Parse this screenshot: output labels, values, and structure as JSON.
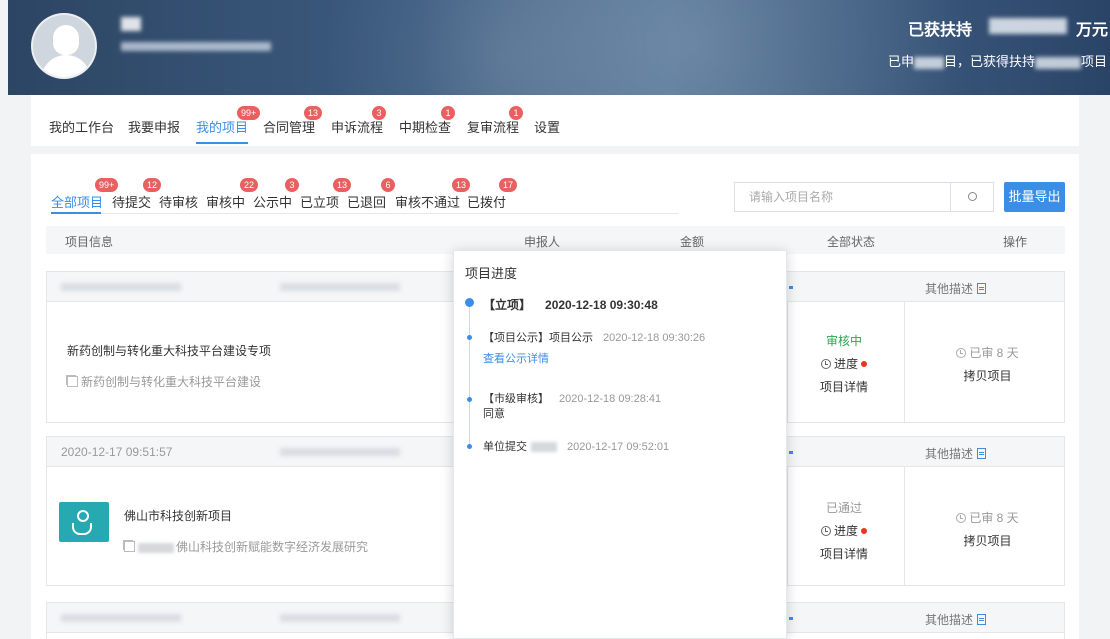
{
  "header": {
    "support_title": "已获扶持",
    "support_unit": "万元",
    "support_sub_a": "已申",
    "support_sub_b": "目，已获得扶持",
    "support_sub_c": "项目"
  },
  "nav": {
    "items": [
      {
        "label": "我的工作台"
      },
      {
        "label": "我要申报"
      },
      {
        "label": "我的项目",
        "badge": "99+"
      },
      {
        "label": "合同管理",
        "badge": "13"
      },
      {
        "label": "申诉流程",
        "badge": "3"
      },
      {
        "label": "中期检查",
        "badge": "1"
      },
      {
        "label": "复审流程",
        "badge": "1"
      },
      {
        "label": "设置"
      }
    ]
  },
  "filters": [
    {
      "label": "全部项目",
      "badge": "99+"
    },
    {
      "label": "待提交",
      "badge": "12"
    },
    {
      "label": "待审核"
    },
    {
      "label": "审核中",
      "badge": "22"
    },
    {
      "label": "公示中",
      "badge": "3"
    },
    {
      "label": "已立项",
      "badge": "13"
    },
    {
      "label": "已退回",
      "badge": "6"
    },
    {
      "label": "审核不通过",
      "badge": "13"
    },
    {
      "label": "已拨付",
      "badge": "17"
    }
  ],
  "search": {
    "placeholder": "请输入项目名称"
  },
  "export_label": "批量导出",
  "table": {
    "headers": [
      "项目信息",
      "申报人",
      "金额",
      "全部状态",
      "操作"
    ]
  },
  "rows": [
    {
      "time": "",
      "name": "新药创制与转化重大科技平台建设专项",
      "sub": "新药创制与转化重大科技平台建设",
      "status": "审核中",
      "progress": "进度",
      "detail": "项目详情",
      "days": "已审 8 天",
      "copy": "拷贝项目",
      "other": "其他描述"
    },
    {
      "time": "2020-12-17 09:51:57",
      "name": "佛山市科技创新项目",
      "sub": "佛山科技创新赋能数字经济发展研究",
      "status": "已通过",
      "progress": "进度",
      "detail": "项目详情",
      "days": "已审 8 天",
      "copy": "拷贝项目",
      "other": "其他描述"
    },
    {
      "other": "其他描述"
    }
  ],
  "popup": {
    "title": "项目进度",
    "steps": [
      {
        "label": "【立项】",
        "time": "2020-12-18 09:30:48"
      },
      {
        "label": "【项目公示】项目公示",
        "time": "2020-12-18 09:30:26",
        "link": "查看公示详情"
      },
      {
        "label": "【市级审核】",
        "time": "2020-12-18 09:28:41",
        "note": "同意"
      },
      {
        "label": "单位提交",
        "time": "2020-12-17 09:52:01"
      }
    ]
  },
  "colors": {
    "accent": "#3a8ee6",
    "badge": "#e86060",
    "success": "#2ea44f",
    "danger": "#e8361e",
    "logo_teal": "#26a9b0"
  }
}
